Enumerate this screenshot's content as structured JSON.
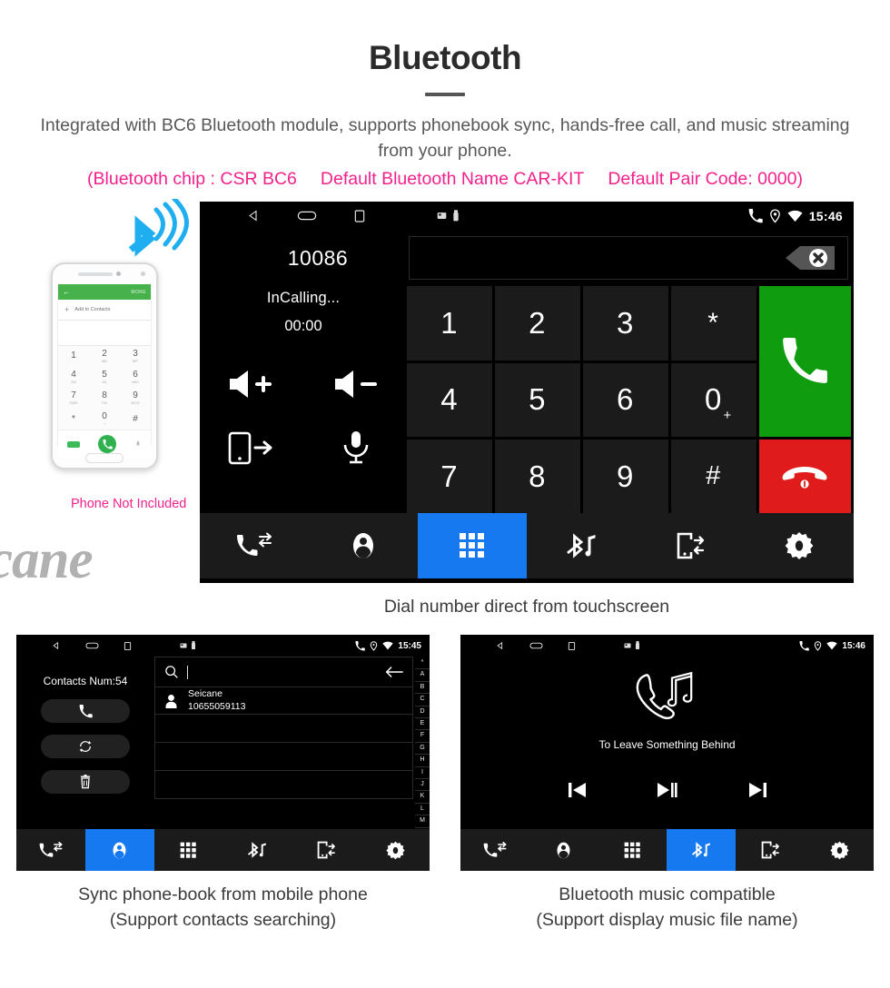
{
  "header": {
    "title": "Bluetooth",
    "subtitle": "Integrated with BC6 Bluetooth module, supports phonebook sync, hands-free call, and music streaming from your phone.",
    "spec_line": {
      "chip": "(Bluetooth chip : CSR BC6",
      "name": "Default Bluetooth Name CAR-KIT",
      "pair": "Default Pair Code: 0000)",
      "color": "#f2218c"
    }
  },
  "phone_mockup": {
    "note": "Phone Not Included",
    "note_color": "#f2218c",
    "appbar": {
      "back_icon": "back-arrow-icon",
      "more_label": "MORE",
      "color": "#47b14b"
    },
    "add_contacts_label": "Add to Contacts",
    "keys": [
      {
        "digit": "1",
        "sub": ""
      },
      {
        "digit": "2",
        "sub": "ABC"
      },
      {
        "digit": "3",
        "sub": "DEF"
      },
      {
        "digit": "4",
        "sub": "GHI"
      },
      {
        "digit": "5",
        "sub": "JKL"
      },
      {
        "digit": "6",
        "sub": "MNO"
      },
      {
        "digit": "7",
        "sub": "PQRS"
      },
      {
        "digit": "8",
        "sub": "TUV"
      },
      {
        "digit": "9",
        "sub": "WXYZ"
      },
      {
        "digit": "*",
        "sub": ""
      },
      {
        "digit": "0",
        "sub": "+"
      },
      {
        "digit": "#",
        "sub": ""
      }
    ],
    "bluetooth_icon": "bluetooth-signal-icon",
    "bluetooth_color": "#1faef0"
  },
  "main_unit": {
    "status_bar": {
      "back_icon": "back-triangle-icon",
      "home_icon": "home-oval-icon",
      "recents_icon": "recents-square-icon",
      "sdcard_icon": "sdcard-icon",
      "usb_icon": "usb-icon",
      "call_icon": "phone-handset-icon",
      "location_icon": "location-pin-icon",
      "wifi_icon": "wifi-icon",
      "time": "15:46"
    },
    "dialed_number": "10086",
    "input_value": "",
    "backspace_icon": "backspace-delete-icon",
    "call_state": "InCalling...",
    "call_timer": "00:00",
    "controls": [
      {
        "name": "volume-up-icon",
        "label": "Volume Up"
      },
      {
        "name": "volume-down-icon",
        "label": "Volume Down"
      },
      {
        "name": "transfer-to-phone-icon",
        "label": "Transfer To Phone"
      },
      {
        "name": "microphone-mute-icon",
        "label": "Microphone"
      }
    ],
    "keypad": [
      "1",
      "2",
      "3",
      "*",
      "4",
      "5",
      "6",
      "0",
      "7",
      "8",
      "9",
      "#"
    ],
    "zero_plus": "+",
    "call_button": {
      "icon": "call-answer-icon",
      "color": "#0f9d0f"
    },
    "hangup_button": {
      "icon": "call-end-icon",
      "color": "#e01b1b"
    },
    "tabs": [
      {
        "name": "tab-call-history",
        "icon": "call-history-icon",
        "active": false
      },
      {
        "name": "tab-contacts",
        "icon": "contacts-person-icon",
        "active": false
      },
      {
        "name": "tab-keypad",
        "icon": "keypad-grid-icon",
        "active": true
      },
      {
        "name": "tab-bluetooth-music",
        "icon": "bluetooth-music-icon",
        "active": false
      },
      {
        "name": "tab-phone-link",
        "icon": "phone-link-icon",
        "active": false
      },
      {
        "name": "tab-settings",
        "icon": "settings-gear-icon",
        "active": false
      }
    ],
    "active_tab_color": "#1779f0",
    "watermark": "Seicane",
    "caption": "Dial number direct from touchscreen"
  },
  "contacts_unit": {
    "status_bar": {
      "time": "15:45"
    },
    "contacts_count_label": "Contacts Num:54",
    "actions": [
      {
        "name": "contacts-call-button",
        "icon": "phone-handset-icon"
      },
      {
        "name": "contacts-sync-button",
        "icon": "sync-refresh-icon"
      },
      {
        "name": "contacts-delete-button",
        "icon": "trash-bin-icon"
      }
    ],
    "search": {
      "icon": "search-magnifier-icon",
      "value": "",
      "placeholder": "",
      "back_icon": "back-arrow-icon"
    },
    "contact": {
      "avatar_icon": "contact-avatar-icon",
      "name": "Seicane",
      "phone": "10655059113"
    },
    "alpha_index": [
      "*",
      "A",
      "B",
      "C",
      "D",
      "E",
      "F",
      "G",
      "H",
      "I",
      "J",
      "K",
      "L",
      "M"
    ],
    "tabs": [
      {
        "name": "tab-call-history",
        "icon": "call-history-icon",
        "active": false
      },
      {
        "name": "tab-contacts",
        "icon": "contacts-person-icon",
        "active": true
      },
      {
        "name": "tab-keypad",
        "icon": "keypad-grid-icon",
        "active": false
      },
      {
        "name": "tab-bluetooth-music",
        "icon": "bluetooth-music-icon",
        "active": false
      },
      {
        "name": "tab-phone-link",
        "icon": "phone-link-icon",
        "active": false
      },
      {
        "name": "tab-settings",
        "icon": "settings-gear-icon",
        "active": false
      }
    ],
    "caption_line1": "Sync phone-book from mobile phone",
    "caption_line2": "(Support contacts searching)"
  },
  "music_unit": {
    "status_bar": {
      "time": "15:46"
    },
    "artwork_icon": "handset-music-note-icon",
    "track_title": "To Leave Something Behind",
    "transport": [
      {
        "name": "previous-track-button",
        "icon": "previous-icon"
      },
      {
        "name": "play-pause-button",
        "icon": "play-pause-icon"
      },
      {
        "name": "next-track-button",
        "icon": "next-icon"
      }
    ],
    "tabs": [
      {
        "name": "tab-call-history",
        "icon": "call-history-icon",
        "active": false
      },
      {
        "name": "tab-contacts",
        "icon": "contacts-person-icon",
        "active": false
      },
      {
        "name": "tab-keypad",
        "icon": "keypad-grid-icon",
        "active": false
      },
      {
        "name": "tab-bluetooth-music",
        "icon": "bluetooth-music-icon",
        "active": true
      },
      {
        "name": "tab-phone-link",
        "icon": "phone-link-icon",
        "active": false
      },
      {
        "name": "tab-settings",
        "icon": "settings-gear-icon",
        "active": false
      }
    ],
    "caption_line1": "Bluetooth music compatible",
    "caption_line2": "(Support display music file name)"
  }
}
